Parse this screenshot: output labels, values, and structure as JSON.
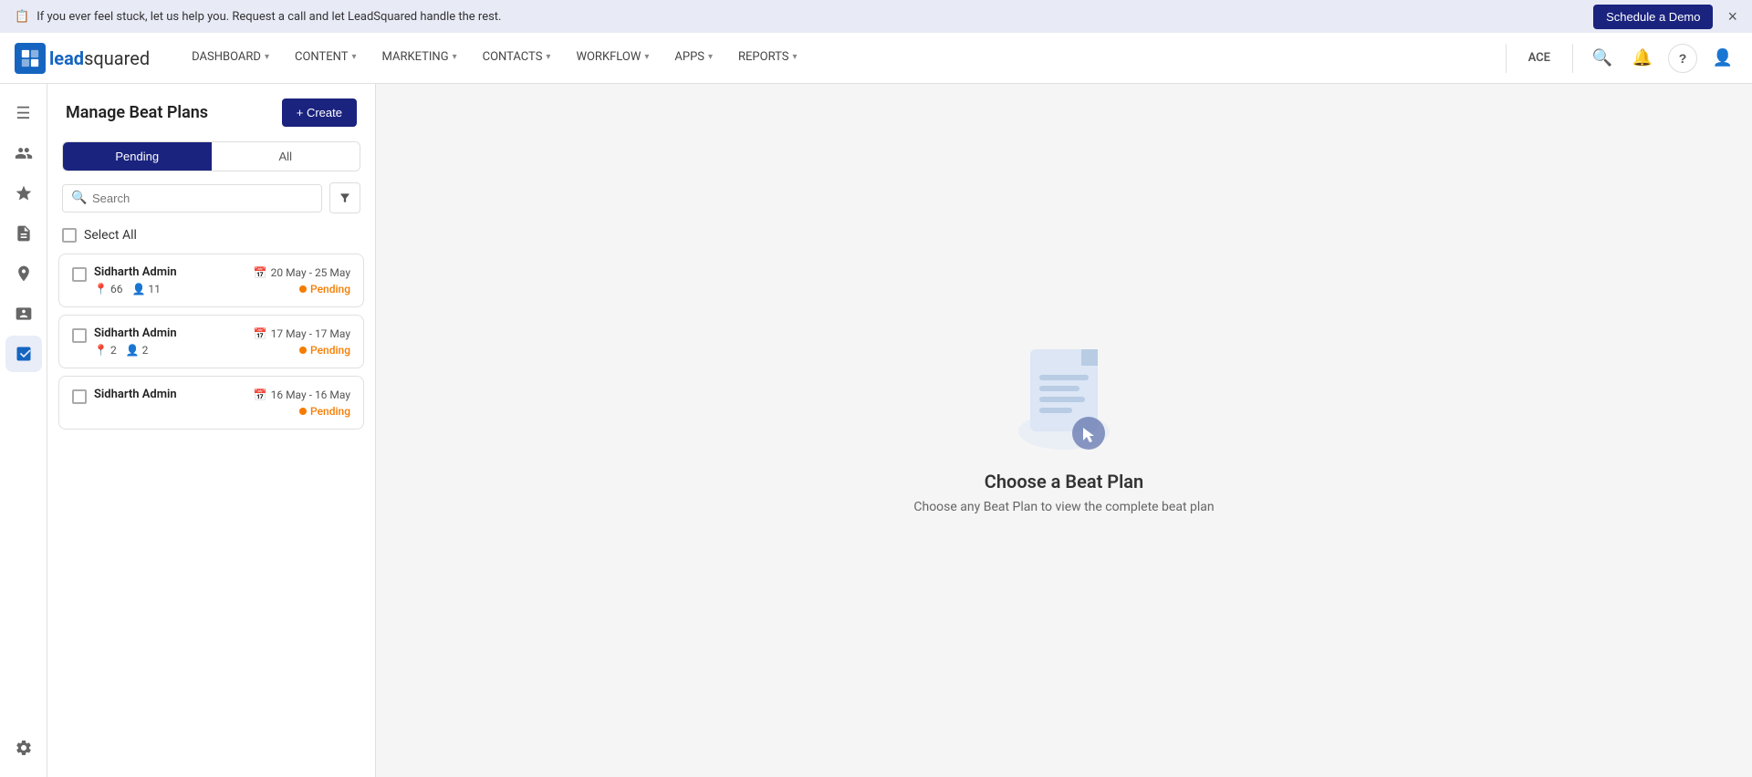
{
  "announcement": {
    "text": "If you ever feel stuck, let us help you. Request a call and let LeadSquared handle the rest.",
    "schedule_btn": "Schedule a Demo",
    "close_icon": "×"
  },
  "nav": {
    "logo_text_lead": "lead",
    "logo_text_squared": "squared",
    "items": [
      {
        "label": "DASHBOARD",
        "key": "dashboard"
      },
      {
        "label": "CONTENT",
        "key": "content"
      },
      {
        "label": "MARKETING",
        "key": "marketing"
      },
      {
        "label": "CONTACTS",
        "key": "contacts"
      },
      {
        "label": "WORKFLOW",
        "key": "workflow"
      },
      {
        "label": "APPS",
        "key": "apps"
      },
      {
        "label": "REPORTS",
        "key": "reports"
      }
    ],
    "ace_label": "ACE",
    "search_icon": "🔍",
    "bell_icon": "🔔",
    "help_icon": "?",
    "user_icon": "👤"
  },
  "sidebar": {
    "icons": [
      {
        "key": "menu",
        "symbol": "☰"
      },
      {
        "key": "contacts-group",
        "symbol": "👥"
      },
      {
        "key": "star-contact",
        "symbol": "⭐"
      },
      {
        "key": "document",
        "symbol": "📋"
      },
      {
        "key": "person-pin",
        "symbol": "📍"
      },
      {
        "key": "contact-card",
        "symbol": "👤"
      },
      {
        "key": "beat-plan",
        "symbol": "📊"
      }
    ],
    "bottom_icon": {
      "key": "settings",
      "symbol": "⚙"
    }
  },
  "beat_panel": {
    "title": "Manage Beat Plans",
    "create_btn": "+ Create",
    "tabs": [
      {
        "label": "Pending",
        "key": "pending",
        "active": true
      },
      {
        "label": "All",
        "key": "all",
        "active": false
      }
    ],
    "search_placeholder": "Search",
    "filter_icon": "▼",
    "select_all_label": "Select All",
    "cards": [
      {
        "name": "Sidharth Admin",
        "date_range": "20 May - 25 May",
        "locations": "66",
        "people": "11",
        "status": "Pending"
      },
      {
        "name": "Sidharth Admin",
        "date_range": "17 May - 17 May",
        "locations": "2",
        "people": "2",
        "status": "Pending"
      },
      {
        "name": "Sidharth Admin",
        "date_range": "16 May - 16 May",
        "locations": "",
        "people": "",
        "status": "Pending"
      }
    ]
  },
  "main": {
    "empty_title": "Choose a Beat Plan",
    "empty_subtitle": "Choose any Beat Plan to view the complete beat plan"
  }
}
